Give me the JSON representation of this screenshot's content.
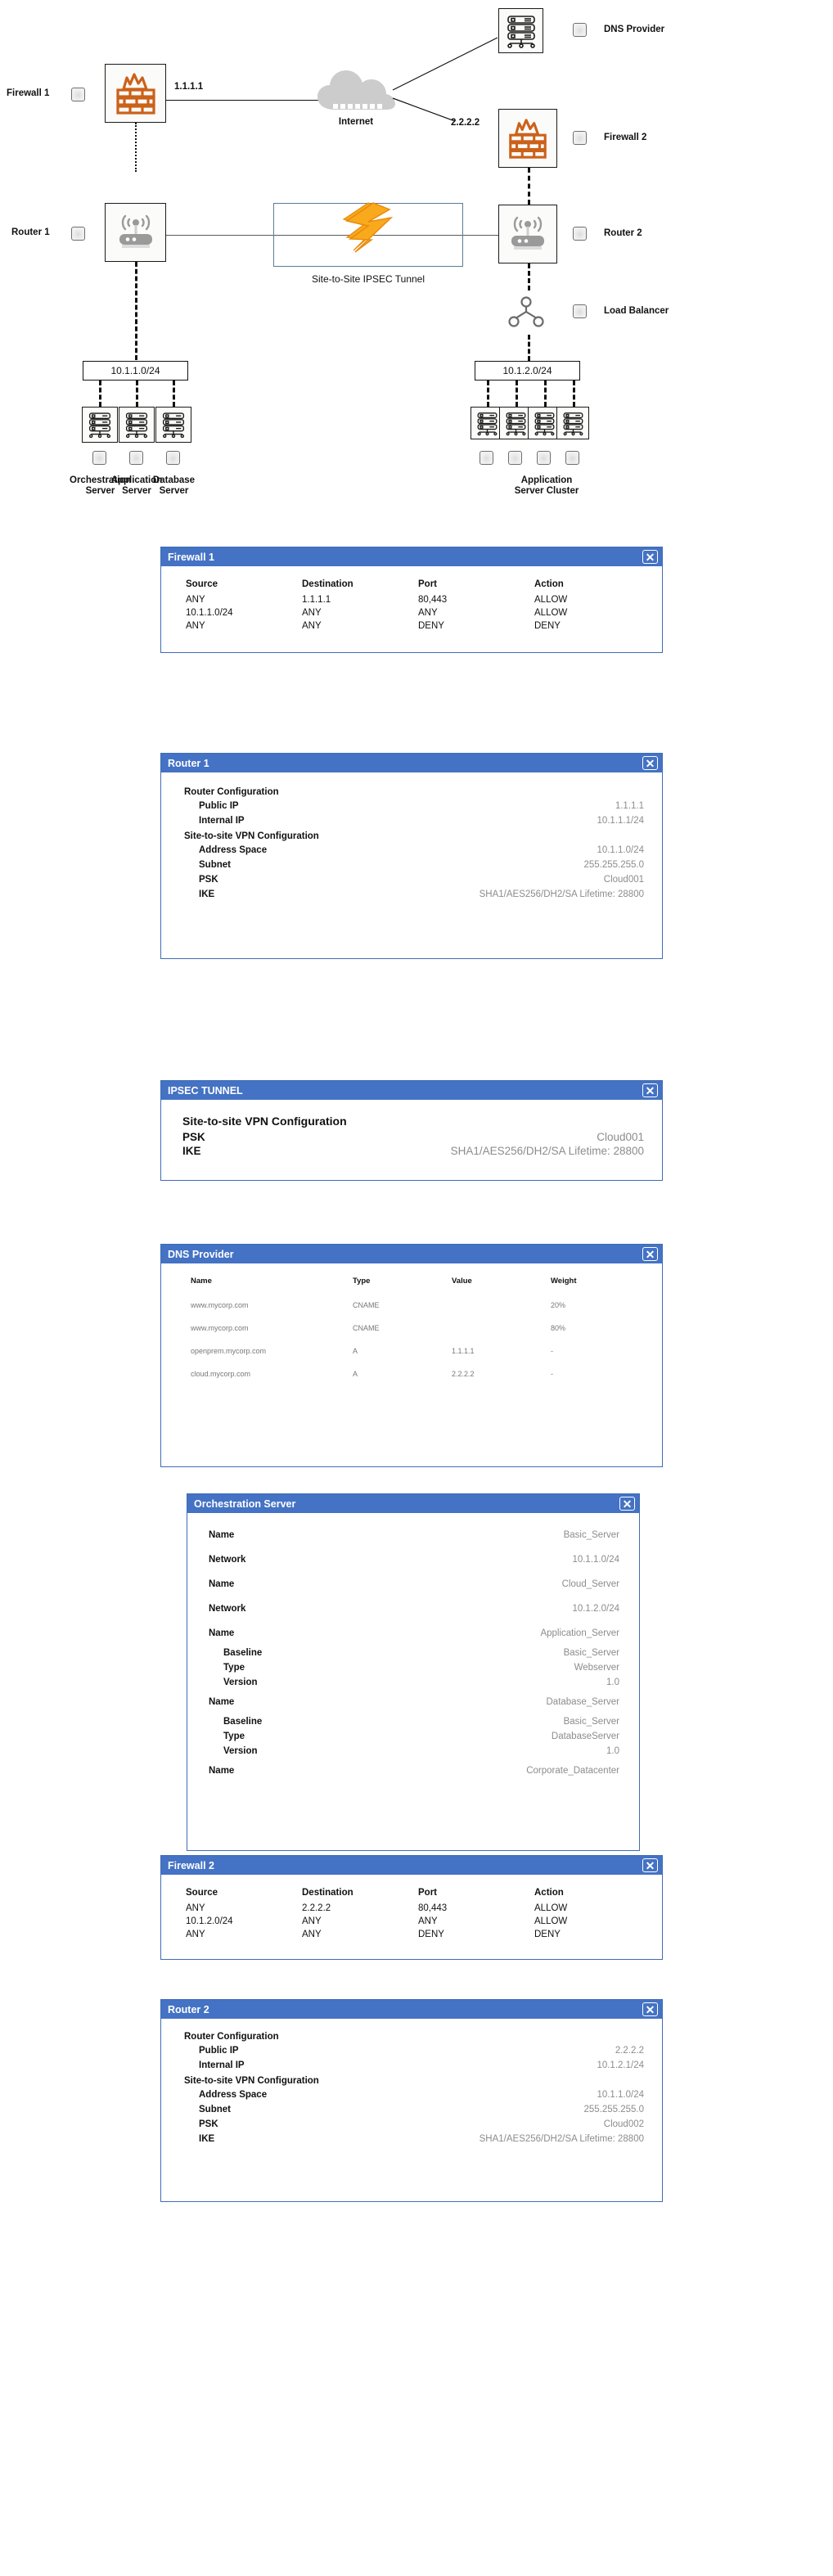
{
  "diagram": {
    "nodes": {
      "firewall1": {
        "label": "Firewall 1",
        "ip": "1.1.1.1"
      },
      "firewall2": {
        "label": "Firewall 2",
        "ip": "2.2.2.2"
      },
      "router1": {
        "label": "Router 1"
      },
      "router2": {
        "label": "Router 2"
      },
      "internet": {
        "label": "Internet"
      },
      "dns": {
        "label": "DNS Provider"
      },
      "loadbalancer": {
        "label": "Load Balancer"
      },
      "tunnel": {
        "label": "Site-to-Site IPSEC Tunnel"
      },
      "net_left": {
        "label": "10.1.1.0/24"
      },
      "net_right": {
        "label": "10.1.2.0/24"
      },
      "orchestration": {
        "label": "Orchestration\nServer",
        "line1": "Orchestration",
        "line2": "Server"
      },
      "application_left": {
        "line1": "Application",
        "line2": "Server"
      },
      "database": {
        "line1": "Database",
        "line2": "Server"
      },
      "app_cluster": {
        "line1": "Application",
        "line2": "Server Cluster"
      }
    }
  },
  "panels": {
    "firewall1": {
      "title": "Firewall 1",
      "close": "✕",
      "headers": [
        "Source",
        "Destination",
        "Port",
        "Action"
      ],
      "rows": [
        [
          "ANY",
          "1.1.1.1",
          "80,443",
          "ALLOW"
        ],
        [
          "10.1.1.0/24",
          "ANY",
          "ANY",
          "ALLOW"
        ],
        [
          "ANY",
          "ANY",
          "DENY",
          "DENY"
        ]
      ]
    },
    "router1": {
      "title": "Router 1",
      "close": "✕",
      "section1": "Router Configuration",
      "rows1": [
        {
          "k": "Public IP",
          "v": "1.1.1.1"
        },
        {
          "k": "Internal IP",
          "v": "10.1.1.1/24"
        }
      ],
      "section2": "Site-to-site VPN Configuration",
      "rows2": [
        {
          "k": "Address Space",
          "v": "10.1.1.0/24"
        },
        {
          "k": "Subnet",
          "v": "255.255.255.0"
        },
        {
          "k": "PSK",
          "v": "Cloud001"
        },
        {
          "k": "IKE",
          "v": "SHA1/AES256/DH2/SA Lifetime: 28800"
        }
      ]
    },
    "ipsec": {
      "title": "IPSEC TUNNEL",
      "close": "✕",
      "section": "Site-to-site VPN Configuration",
      "rows": [
        {
          "k": "PSK",
          "v": "Cloud001"
        },
        {
          "k": "IKE",
          "v": "SHA1/AES256/DH2/SA Lifetime: 28800"
        }
      ]
    },
    "dns": {
      "title": "DNS Provider",
      "close": "✕",
      "headers": [
        "Name",
        "Type",
        "Value",
        "Weight"
      ],
      "rows": [
        [
          "www.mycorp.com",
          "CNAME",
          "",
          "20%"
        ],
        [
          "www.mycorp.com",
          "CNAME",
          "",
          "80%"
        ],
        [
          "openprem.mycorp.com",
          "A",
          "1.1.1.1",
          "-"
        ],
        [
          "cloud.mycorp.com",
          "A",
          "2.2.2.2",
          "-"
        ]
      ]
    },
    "orchestration": {
      "title": "Orchestration Server",
      "close": "✕",
      "rows": [
        {
          "k": "Name",
          "v": "Basic_Server",
          "indent": 0
        },
        {
          "k": "Network",
          "v": "10.1.1.0/24",
          "indent": 1
        },
        {
          "k": "Name",
          "v": "Cloud_Server",
          "indent": 0
        },
        {
          "k": "Network",
          "v": "10.1.2.0/24",
          "indent": 1
        },
        {
          "k": "Name",
          "v": "Application_Server",
          "indent": 0
        },
        {
          "k": "Baseline",
          "v": "Basic_Server",
          "indent": 1
        },
        {
          "k": "Type",
          "v": "Webserver",
          "indent": 1
        },
        {
          "k": "Version",
          "v": "1.0",
          "indent": 1
        },
        {
          "k": "Name",
          "v": "Database_Server",
          "indent": 0
        },
        {
          "k": "Baseline",
          "v": "Basic_Server",
          "indent": 1
        },
        {
          "k": "Type",
          "v": "DatabaseServer",
          "indent": 1
        },
        {
          "k": "Version",
          "v": "1.0",
          "indent": 1
        },
        {
          "k": "Name",
          "v": "Corporate_Datacenter",
          "indent": 0
        }
      ]
    },
    "firewall2": {
      "title": "Firewall 2",
      "close": "✕",
      "headers": [
        "Source",
        "Destination",
        "Port",
        "Action"
      ],
      "rows": [
        [
          "ANY",
          "2.2.2.2",
          "80,443",
          "ALLOW"
        ],
        [
          "10.1.2.0/24",
          "ANY",
          "ANY",
          "ALLOW"
        ],
        [
          "ANY",
          "ANY",
          "DENY",
          "DENY"
        ]
      ]
    },
    "router2": {
      "title": "Router 2",
      "close": "✕",
      "section1": "Router Configuration",
      "rows1": [
        {
          "k": "Public IP",
          "v": "2.2.2.2"
        },
        {
          "k": "Internal IP",
          "v": "10.1.2.1/24"
        }
      ],
      "section2": "Site-to-site VPN Configuration",
      "rows2": [
        {
          "k": "Address Space",
          "v": "10.1.1.0/24"
        },
        {
          "k": "Subnet",
          "v": "255.255.255.0"
        },
        {
          "k": "PSK",
          "v": "Cloud002"
        },
        {
          "k": "IKE",
          "v": "SHA1/AES256/DH2/SA Lifetime: 28800"
        }
      ]
    }
  },
  "colors": {
    "header_blue": "#4472c4",
    "firewall_orange": "#cc6119",
    "cloud_gray": "#cccccc",
    "bolt_orange": "#f5a623",
    "value_gray": "#8c8c8c"
  }
}
